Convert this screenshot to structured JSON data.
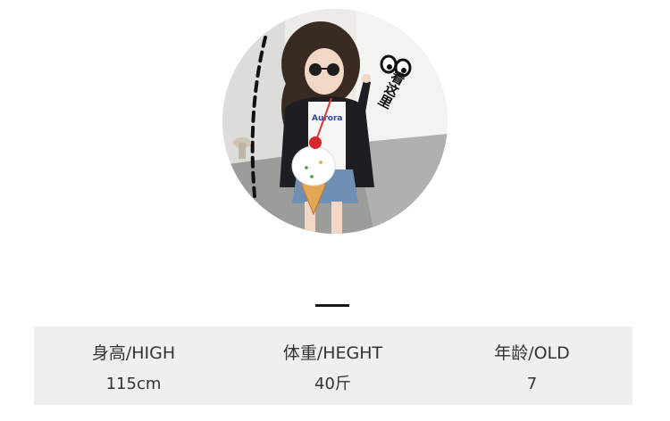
{
  "photo": {
    "sticker_text": "看这里",
    "shirt_text": "Aurora"
  },
  "spec_table": {
    "columns": [
      {
        "header": "身高/HIGH",
        "value": "115cm"
      },
      {
        "header": "体重/HEGHT",
        "value": "40斤"
      },
      {
        "header": "年龄/OLD",
        "value": "7"
      }
    ]
  },
  "colors": {
    "divider": "#1a1a1a",
    "table_background": "#efefef",
    "text": "#333333"
  }
}
